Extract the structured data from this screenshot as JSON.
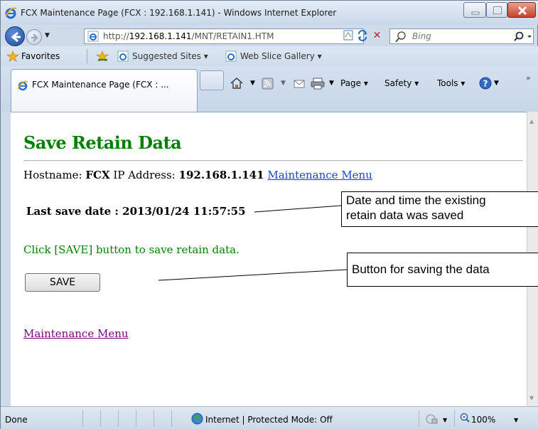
{
  "window": {
    "title": "FCX Maintenance Page (FCX : 192.168.1.141) - Windows Internet Explorer"
  },
  "address_bar": {
    "prefix": "http://",
    "host": "192.168.1.141",
    "path": "/MNT/RETAIN1.HTM"
  },
  "search": {
    "placeholder": "Bing"
  },
  "favorites_bar": {
    "favorites_label": "Favorites",
    "suggested_sites": "Suggested Sites ▾",
    "web_slice_gallery": "Web Slice Gallery ▾"
  },
  "tab": {
    "label": "FCX Maintenance Page (FCX : ..."
  },
  "command_bar": {
    "page": "Page ▾",
    "safety": "Safety ▾",
    "tools": "Tools ▾"
  },
  "content": {
    "heading": "Save Retain Data",
    "hostname_label": "Hostname:",
    "hostname_value": "FCX",
    "ip_label": "IP Address:",
    "ip_value": "192.168.1.141",
    "maintenance_menu_link": "Maintenance Menu",
    "last_save": "Last save date : 2013/01/24 11:57:55",
    "instruction": "Click [SAVE] button to save retain data.",
    "save_button": "SAVE",
    "bottom_link": "Maintenance Menu"
  },
  "status_bar": {
    "status": "Done",
    "zone": "Internet | Protected Mode: Off",
    "zoom": "100%"
  },
  "annotations": {
    "date_callout_line1": "Date and time the existing",
    "date_callout_line2": "retain data was saved",
    "button_callout": "Button for saving the data"
  },
  "colors": {
    "heading": "#008000",
    "link_unvisited": "#1a44c7",
    "link_visited": "#800080",
    "instruction_text": "#008000"
  }
}
